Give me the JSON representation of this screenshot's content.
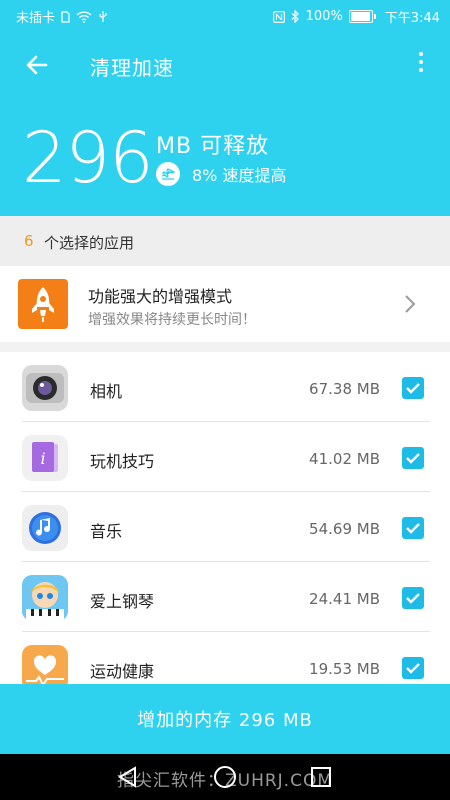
{
  "status_bar": {
    "carrier": "未插卡",
    "battery": "100%",
    "time": "下午3:44"
  },
  "appbar": {
    "title": "清理加速"
  },
  "summary": {
    "amount": "296",
    "unit_label": "MB 可释放",
    "speed_text": "8% 速度提高"
  },
  "section": {
    "count": "6",
    "label": "个选择的应用"
  },
  "boost_card": {
    "title": "功能强大的增强模式",
    "subtitle": "增强效果将持续更长时间！"
  },
  "apps": [
    {
      "name": "相机",
      "size": "67.38 MB",
      "checked": true,
      "icon": "camera-app-icon"
    },
    {
      "name": "玩机技巧",
      "size": "41.02 MB",
      "checked": true,
      "icon": "tips-app-icon"
    },
    {
      "name": "音乐",
      "size": "54.69 MB",
      "checked": true,
      "icon": "music-app-icon"
    },
    {
      "name": "爱上钢琴",
      "size": "24.41 MB",
      "checked": true,
      "icon": "piano-game-app-icon"
    },
    {
      "name": "运动健康",
      "size": "19.53 MB",
      "checked": true,
      "icon": "health-app-icon"
    }
  ],
  "bottom_button": {
    "label": "增加的内存 296 MB"
  },
  "watermark": {
    "text": "指尖汇软件：ZUHRJ.COM"
  },
  "colors": {
    "primary": "#2fd2ee",
    "checkbox": "#1fbbe7",
    "accent_count": "#f3971c",
    "boost_icon_bg": "#f47f17"
  }
}
